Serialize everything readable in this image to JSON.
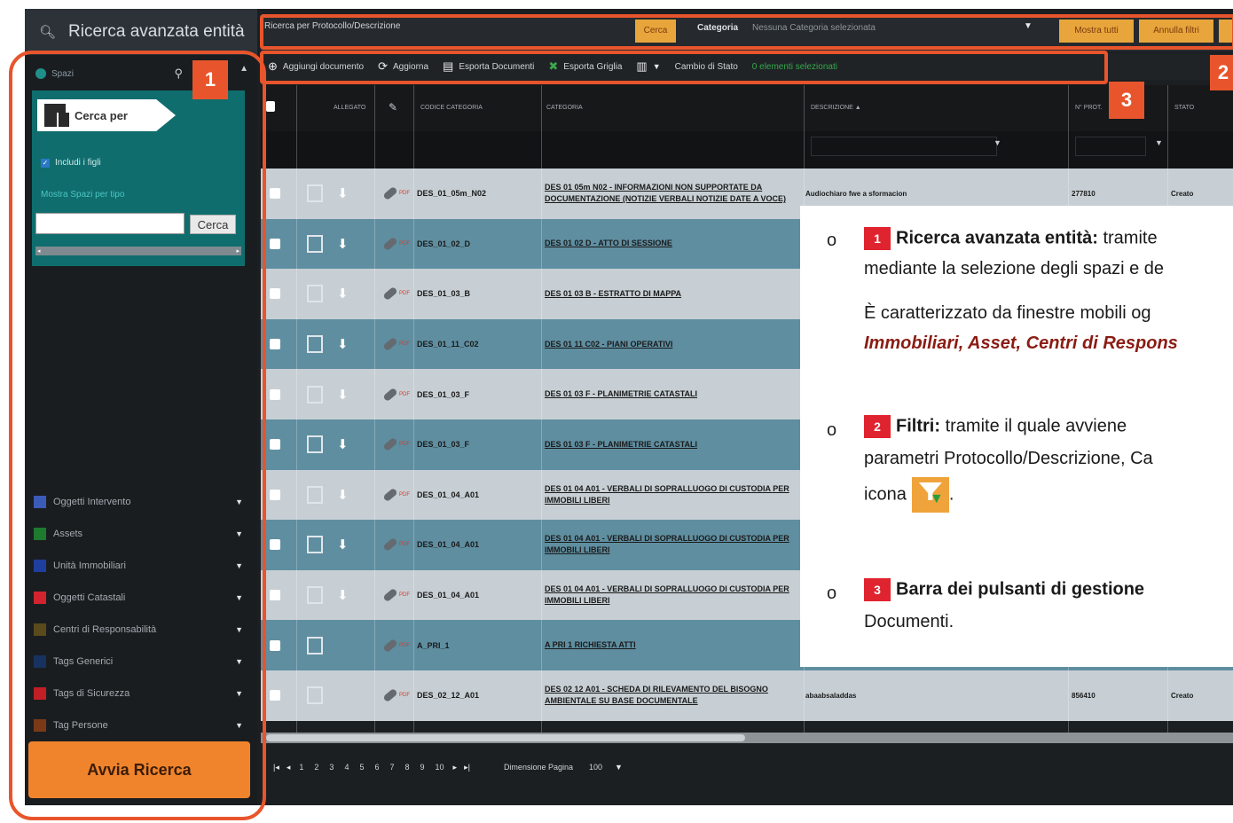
{
  "left_panel": {
    "title": "Ricerca avanzata entità",
    "spazi_label": "Spazi",
    "cerca_per_label": "Cerca per",
    "includi_figli_label": "Includi i figli",
    "link_label": "Mostra Spazi per tipo",
    "search_input_value": "",
    "search_button_label": "Cerca",
    "filters": [
      {
        "label": "Oggetti Intervento",
        "color": "#3a5bb8"
      },
      {
        "label": "Assets",
        "color": "#1e7a2e"
      },
      {
        "label": "Unità Immobiliari",
        "color": "#1f3f9e"
      },
      {
        "label": "Oggetti Catastali",
        "color": "#d1242e"
      },
      {
        "label": "Centri di Responsabilità",
        "color": "#5a4a1c"
      },
      {
        "label": "Tags Generici",
        "color": "#17325f"
      },
      {
        "label": "Tags di Sicurezza",
        "color": "#c21e25"
      },
      {
        "label": "Tag Persone",
        "color": "#7a3a18"
      }
    ],
    "avvia_label": "Avvia Ricerca"
  },
  "top_filter_bar": {
    "protocol_placeholder": "Ricerca per Protocollo/Descrizione",
    "cerca_label": "Cerca",
    "categoria_label": "Categoria",
    "categoria_value": "Nessuna Categoria selezionata",
    "mostra_tutti_label": "Mostra tutti",
    "annulla_filtri_label": "Annulla filtri"
  },
  "toolbar": {
    "add_label": "Aggiungi documento",
    "refresh_label": "Aggiorna",
    "export_docs_label": "Esporta Documenti",
    "export_grid_label": "Esporta Griglia",
    "state_change_label": "Cambio di Stato",
    "selected_info": "0 elementi selezionati"
  },
  "grid": {
    "headers": {
      "allegato": "ALLEGATO",
      "codice": "CODICE CATEGORIA",
      "categoria": "CATEGORIA",
      "descrizione": "DESCRIZIONE ▲",
      "num": "N° PROT.",
      "stato": "STATO"
    },
    "rows": [
      {
        "code": "DES_01_05m_N02",
        "category": "DES 01 05m N02 - INFORMAZIONI NON SUPPORTATE DA DOCUMENTAZIONE (NOTIZIE VERBALI NOTIZIE DATE A VOCE)",
        "desc": "Audiochiaro fwe a sformacion",
        "num": "277810",
        "stato": "Creato"
      },
      {
        "code": "DES_01_02_D",
        "category": "DES 01 02 D - ATTO DI SESSIONE",
        "desc": "",
        "num": "",
        "stato": ""
      },
      {
        "code": "DES_01_03_B",
        "category": "DES 01 03 B - ESTRATTO DI MAPPA",
        "desc": "",
        "num": "",
        "stato": ""
      },
      {
        "code": "DES_01_11_C02",
        "category": "DES 01 11 C02 - PIANI OPERATIVI",
        "desc": "",
        "num": "",
        "stato": ""
      },
      {
        "code": "DES_01_03_F",
        "category": "DES 01 03 F - PLANIMETRIE CATASTALI",
        "desc": "",
        "num": "",
        "stato": ""
      },
      {
        "code": "DES_01_03_F",
        "category": "DES 01 03 F - PLANIMETRIE CATASTALI",
        "desc": "",
        "num": "",
        "stato": ""
      },
      {
        "code": "DES_01_04_A01",
        "category": "DES 01 04 A01 - VERBALI DI SOPRALLUOGO DI CUSTODIA PER IMMOBILI LIBERI",
        "desc": "",
        "num": "",
        "stato": ""
      },
      {
        "code": "DES_01_04_A01",
        "category": "DES 01 04 A01 - VERBALI DI SOPRALLUOGO DI CUSTODIA PER IMMOBILI LIBERI",
        "desc": "",
        "num": "",
        "stato": ""
      },
      {
        "code": "DES_01_04_A01",
        "category": "DES 01 04 A01 - VERBALI DI SOPRALLUOGO DI CUSTODIA PER IMMOBILI LIBERI",
        "desc": "",
        "num": "",
        "stato": ""
      },
      {
        "code": "A_PRI_1",
        "category": "A PRI 1 RICHIESTA ATTI",
        "desc": "",
        "num": "",
        "stato": ""
      },
      {
        "code": "DES_02_12_A01",
        "category": "DES 02 12 A01 - SCHEDA DI RILEVAMENTO DEL BISOGNO AMBIENTALE SU BASE DOCUMENTALE",
        "desc": "abaabsaladdas",
        "num": "856410",
        "stato": "Creato"
      }
    ]
  },
  "pager": {
    "pages": [
      "1",
      "2",
      "3",
      "4",
      "5",
      "6",
      "7",
      "8",
      "9",
      "10"
    ],
    "dim_label": "Dimensione Pagina",
    "page_size": "100"
  },
  "callouts": {
    "one": "1",
    "two": "2",
    "three": "3"
  },
  "overlay": {
    "item1_number": "1",
    "item1_title": "Ricerca avanzata entità:",
    "item1_text_a": "tramite",
    "item1_line2": "mediante la selezione degli spazi e de",
    "item1_line3": "È caratterizzato da finestre mobili og",
    "item1_line4": "Immobiliari, Asset, Centri di Respons",
    "item2_number": "2",
    "item2_title": "Filtri:",
    "item2_text_a": "tramite il quale avviene",
    "item2_line2": "parametri Protocollo/Descrizione, Ca",
    "item2_line3": "icona",
    "item3_number": "3",
    "item3_title": "Barra dei pulsanti di gestione",
    "item3_line2": "Documenti."
  }
}
